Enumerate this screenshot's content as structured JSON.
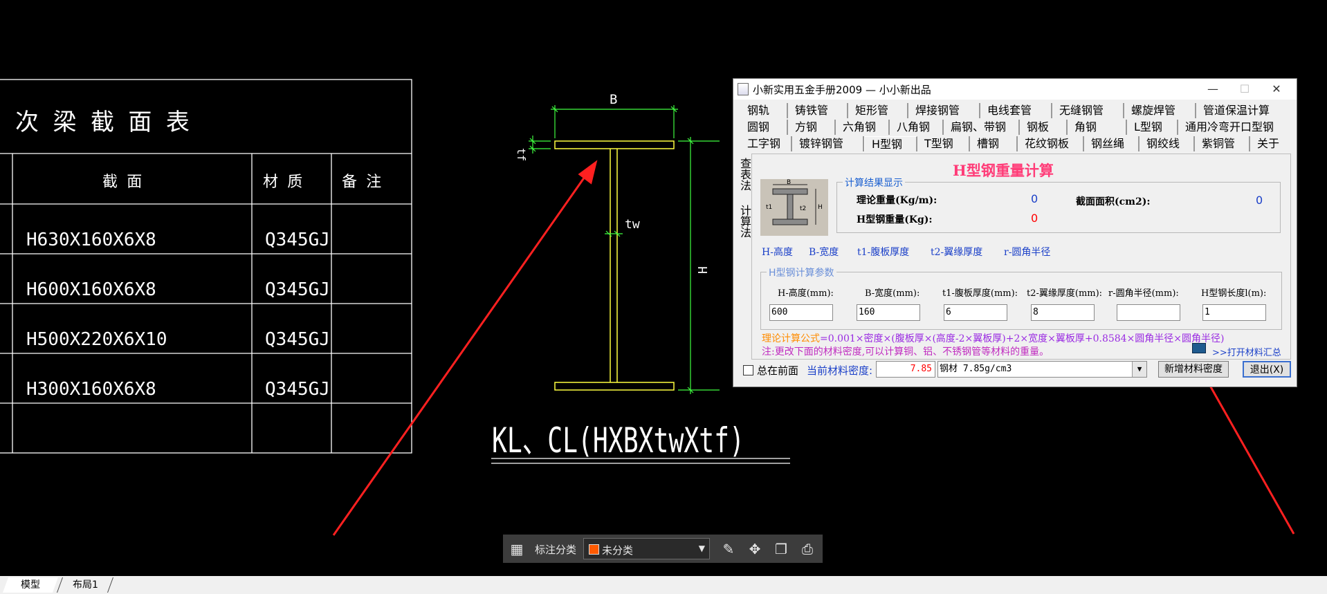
{
  "cad": {
    "table_title": "次 梁 截 面 表",
    "headers": {
      "section": "截 面",
      "material": "材 质",
      "note": "备 注"
    },
    "rows": [
      {
        "section": "H630X160X6X8",
        "material": "Q345GJ"
      },
      {
        "section": "H600X160X6X8",
        "material": "Q345GJ"
      },
      {
        "section": "H500X220X6X10",
        "material": "Q345GJ"
      },
      {
        "section": "H300X160X6X8",
        "material": "Q345GJ"
      }
    ],
    "dim_b": "B",
    "dim_tf": "tf",
    "dim_tw": "tw",
    "dim_h": "H",
    "formula_label": "KL、CL(HXBXtwXtf)"
  },
  "dialog": {
    "title": "小新实用五金手册2009 — 小小新出品",
    "tab_rows": [
      [
        "钢轨",
        "铸铁管",
        "矩形管",
        "焊接钢管",
        "电线套管",
        "无缝钢管",
        "螺旋焊管",
        "管道保温计算"
      ],
      [
        "圆钢",
        "方钢",
        "六角钢",
        "八角钢",
        "扁钢、带钢",
        "钢板",
        "角钢",
        "L型钢",
        "通用冷弯开口型钢"
      ],
      [
        "工字钢",
        "镀锌钢管",
        "H型钢",
        "T型钢",
        "槽钢",
        "花纹钢板",
        "钢丝绳",
        "钢绞线",
        "紫铜管",
        "关于"
      ]
    ],
    "active_tab": "H型钢",
    "side_tabs": [
      "查表法",
      "计算法"
    ],
    "calc_title": "H型钢重量计算",
    "result_group": "计算结果显示",
    "theory_weight_label": "理论重量(Kg/m):",
    "theory_weight_value": "0",
    "section_area_label": "截面面积(cm2):",
    "section_area_value": "0",
    "h_weight_label": "H型钢重量(Kg):",
    "h_weight_value": "0",
    "legend_links": [
      "H-高度",
      "B-宽度",
      "t1-腹板厚度",
      "t2-翼缘厚度",
      "r-圆角半径"
    ],
    "param_group": "H型钢计算参数",
    "params": [
      {
        "label": "H-高度(mm):",
        "value": "600"
      },
      {
        "label": "B-宽度(mm):",
        "value": "160"
      },
      {
        "label": "t1-腹板厚度(mm):",
        "value": "6"
      },
      {
        "label": "t2-翼缘厚度(mm):",
        "value": "8"
      },
      {
        "label": "r-圆角半径(mm):",
        "value": ""
      },
      {
        "label": "H型钢长度l(m):",
        "value": "1"
      }
    ],
    "formula_prefix": "理论计算公式",
    "formula_body": "=0.001×密度×(腹板厚×(高度-2×翼板厚)+2×宽度×翼板厚+0.8584×圆角半径×圆角半径)",
    "note": "注:更改下面的材料密度,可以计算铜、铝、不锈钢管等材料的重量。",
    "open_summary": ">>打开材料汇总",
    "always_on_top": "总在前面",
    "density_label": "当前材料密度:",
    "density_value": "7.85",
    "material_select": "钢材 7.85g/cm3",
    "add_density_btn": "新增材料密度",
    "exit_btn": "退出(X)",
    "colors": {
      "title_pink": "#ff3c78",
      "blue": "#1a3fc8",
      "red": "#ff0000"
    }
  },
  "toolbar": {
    "label": "标注分类",
    "category": "未分类",
    "category_color": "#ff5a00"
  },
  "layout_tabs": [
    "模型",
    "布局1"
  ]
}
